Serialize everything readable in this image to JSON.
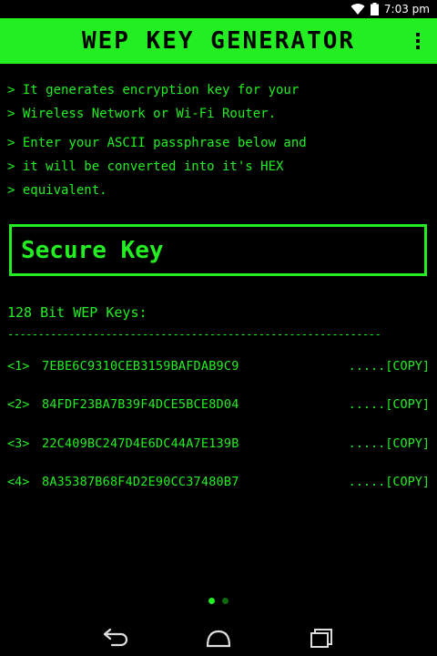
{
  "status_bar": {
    "time": "7:03 pm"
  },
  "header": {
    "title": "WEP KEY GENERATOR"
  },
  "info_lines": [
    "> It generates encryption key for your",
    "> Wireless Network or Wi-Fi Router.",
    "> Enter your ASCII passphrase below and",
    "> it will be converted into it's HEX",
    "> equivalent."
  ],
  "passphrase": {
    "placeholder": "Secure Key",
    "value": ""
  },
  "keys_heading": "128 Bit WEP Keys:",
  "divider": "-------------------------------------------------------------",
  "keys": [
    {
      "index": "<1>",
      "hex": "7EBE6C9310CEB3159BAFDAB9C9",
      "copy_label": ".....[COPY]"
    },
    {
      "index": "<2>",
      "hex": "84FDF23BA7B39F4DCE5BCE8D04",
      "copy_label": ".....[COPY]"
    },
    {
      "index": "<3>",
      "hex": "22C409BC247D4E6DC44A7E139B",
      "copy_label": ".....[COPY]"
    },
    {
      "index": "<4>",
      "hex": "8A35387B68F4D2E90CC37480B7",
      "copy_label": ".....[COPY]"
    }
  ],
  "pager": {
    "current": 1,
    "total": 2
  },
  "icons": {
    "wifi": "wifi-icon",
    "battery": "battery-icon",
    "menu": "overflow-menu-icon",
    "back": "back-icon",
    "home": "home-icon",
    "recents": "recents-icon"
  },
  "colors": {
    "accent": "#22ee22",
    "background": "#000000",
    "accent_dim": "#0b6a0b"
  }
}
